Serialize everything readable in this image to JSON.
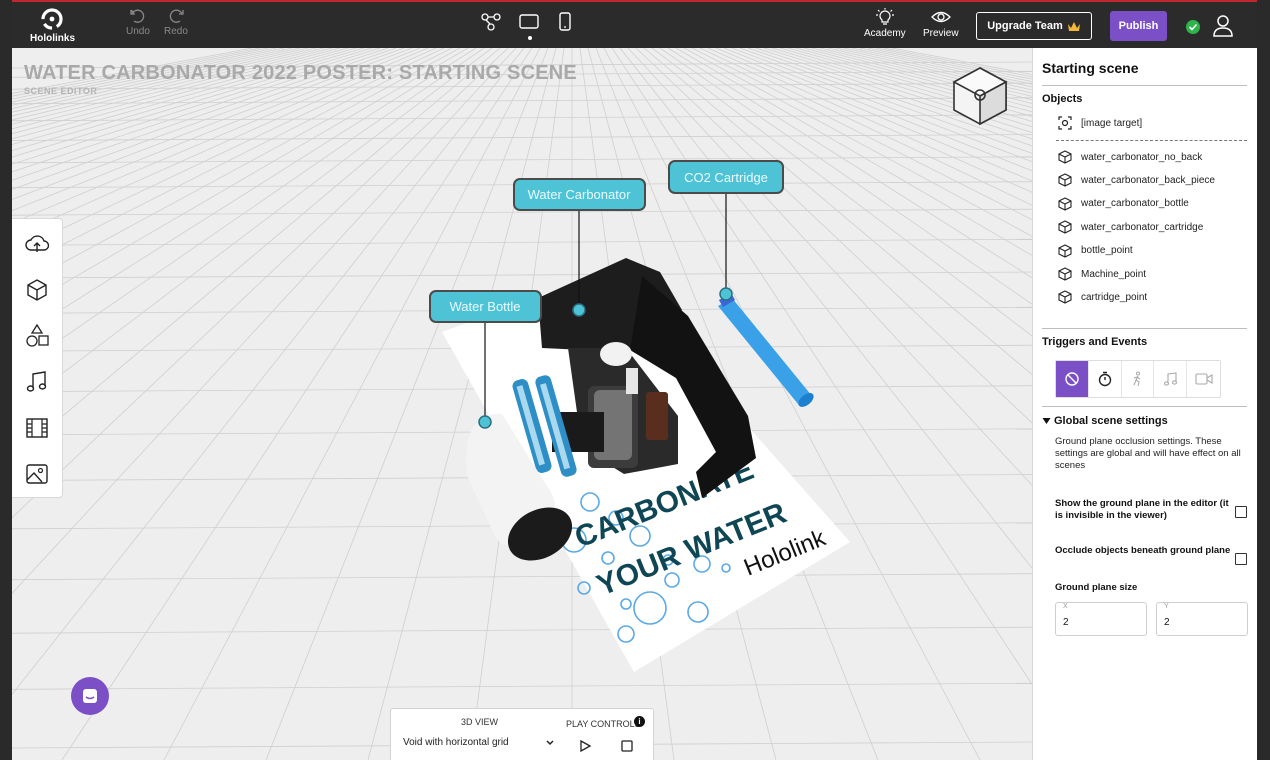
{
  "app": {
    "logo_label": "Hololinks"
  },
  "toolbar": {
    "undo_label": "Undo",
    "redo_label": "Redo",
    "academy_label": "Academy",
    "preview_label": "Preview",
    "upgrade_label": "Upgrade Team",
    "publish_label": "Publish",
    "devices": [
      "flow-diagram-icon",
      "tablet-icon",
      "phone-icon"
    ],
    "selected_device": "tablet-icon"
  },
  "scene": {
    "title": "WATER CARBONATOR 2022 POSTER: STARTING SCENE",
    "subtitle": "SCENE EDITOR",
    "labels": [
      "Water Carbonator",
      "CO2 Cartridge",
      "Water Bottle"
    ],
    "poster_text": [
      "CARBONATE",
      "YOUR WATER",
      "Hololink"
    ]
  },
  "left_tools": [
    "upload-icon",
    "cube-icon",
    "shapes-icon",
    "music-note-icon",
    "film-icon",
    "image-icon"
  ],
  "view_panel": {
    "view_label": "3D VIEW",
    "view_value": "Void with horizontal grid",
    "play_label": "PLAY CONTROLS",
    "info_glyph": "i"
  },
  "right_panel": {
    "title": "Starting scene",
    "objects_heading": "Objects",
    "image_target": "[image target]",
    "objects": [
      "water_carbonator_no_back",
      "water_carbonator_back_piece",
      "water_carbonator_bottle",
      "water_carbonator_cartridge",
      "bottle_point",
      "Machine_point",
      "cartridge_point"
    ],
    "triggers_heading": "Triggers and Events",
    "triggers": [
      "no-trigger-icon",
      "timer-icon",
      "walking-icon",
      "music-icon",
      "video-icon"
    ],
    "active_trigger": "no-trigger-icon",
    "gss_heading": "Global scene settings",
    "gss_desc": "Ground plane occlusion settings. These settings are global and will have effect on all scenes",
    "show_ground_label": "Show the ground plane in the editor (it is invisible in the viewer)",
    "show_ground_checked": false,
    "occlude_label": "Occlude objects beneath ground plane",
    "occlude_checked": false,
    "ground_size_heading": "Ground plane size",
    "size_x_label": "X",
    "size_x": "2",
    "size_y_label": "Y",
    "size_y": "2"
  },
  "colors": {
    "accent": "#7b4fc6",
    "label_fill": "#4fc3d6",
    "success": "#2fb44a",
    "topbar": "#2b2b2b"
  }
}
